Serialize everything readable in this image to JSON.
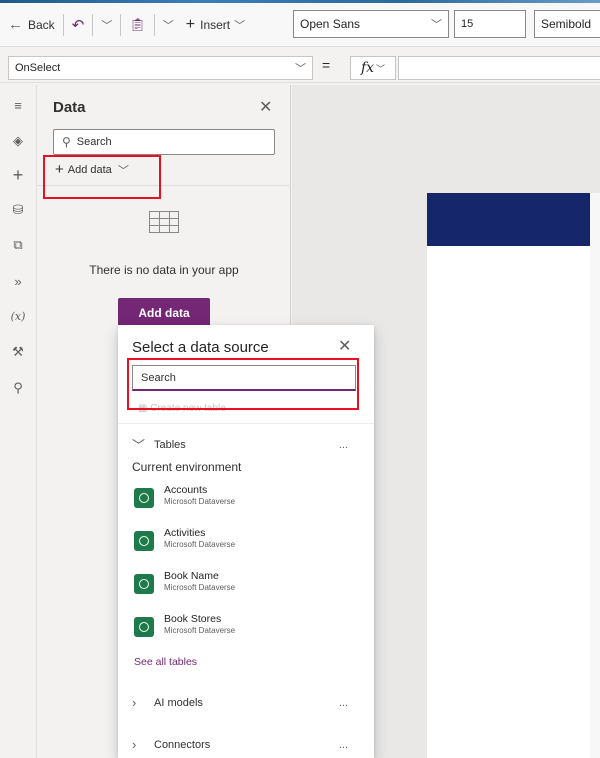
{
  "toolbar": {
    "back_label": "Back",
    "insert_label": "Insert",
    "font": "Open Sans",
    "font_size": "15",
    "font_weight": "Semibold"
  },
  "formula_bar": {
    "property": "OnSelect",
    "equals": "=",
    "fx": "fx"
  },
  "left_rail": {
    "items": [
      "menu-icon",
      "layers-icon",
      "insert-icon",
      "data-icon",
      "media-icon",
      "power-automate-icon",
      "variables-icon",
      "tools-icon",
      "search-icon"
    ]
  },
  "data_panel": {
    "title": "Data",
    "search_placeholder": "Search",
    "add_data_label": "Add data",
    "empty_message": "There is no data in your app",
    "add_data_button": "Add data"
  },
  "flyout": {
    "title": "Select a data source",
    "search_value": "Search",
    "create_table": "Create new table",
    "tables_section": "Tables",
    "environment_label": "Current environment",
    "sources": [
      {
        "name": "Accounts",
        "provider": "Microsoft Dataverse"
      },
      {
        "name": "Activities",
        "provider": "Microsoft Dataverse"
      },
      {
        "name": "Book Name",
        "provider": "Microsoft Dataverse"
      },
      {
        "name": "Book Stores",
        "provider": "Microsoft Dataverse"
      }
    ],
    "see_all": "See all tables",
    "ai_models_section": "AI models",
    "connectors_section": "Connectors",
    "more": "..."
  },
  "colors": {
    "accent": "#742774",
    "header_navy": "#16266a",
    "highlight": "#e81123",
    "dataverse_green": "#1d7b4a"
  }
}
